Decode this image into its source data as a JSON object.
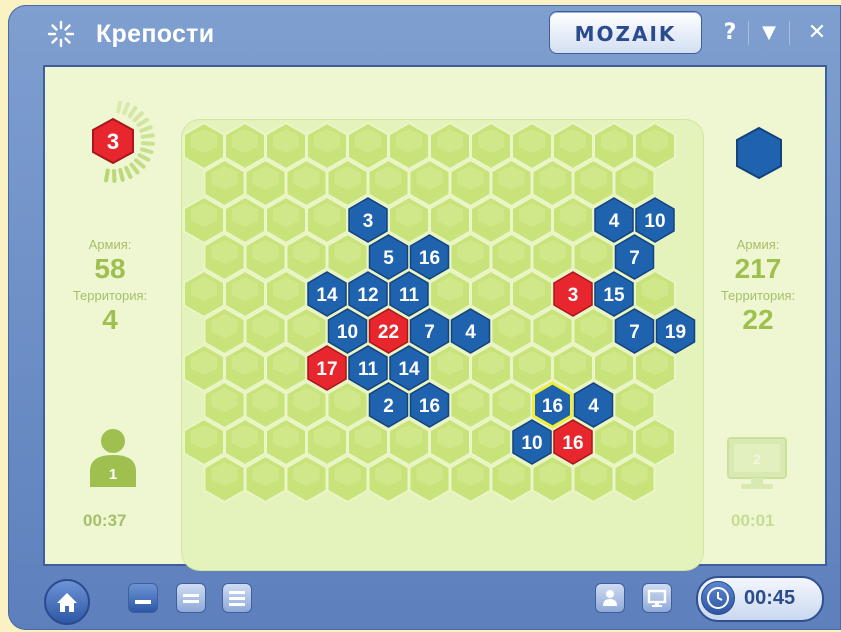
{
  "window": {
    "title": "Крепости",
    "brand": "MOZAIK"
  },
  "controls": {
    "help": "?",
    "menu": "▼",
    "close": "✕"
  },
  "player1": {
    "turn_value": "3",
    "army_label": "Армия:",
    "army": "58",
    "territory_label": "Территория:",
    "territory": "4",
    "avatar_number": "1",
    "time": "00:37",
    "color": "#e8262d"
  },
  "player2": {
    "army_label": "Армия:",
    "army": "217",
    "territory_label": "Территория:",
    "territory": "22",
    "avatar_number": "2",
    "time": "00:01",
    "color": "#1f62ad"
  },
  "bottom": {
    "total_time": "00:45"
  },
  "board": {
    "cols": 12,
    "rows": 10,
    "cells": [
      {
        "c": 4,
        "r": 2,
        "owner": "blue",
        "value": "3"
      },
      {
        "c": 10,
        "r": 2,
        "owner": "blue",
        "value": "4"
      },
      {
        "c": 11,
        "r": 2,
        "owner": "blue",
        "value": "10"
      },
      {
        "c": 4,
        "r": 3,
        "owner": "blue",
        "value": "5"
      },
      {
        "c": 5,
        "r": 3,
        "owner": "blue",
        "value": "16"
      },
      {
        "c": 10,
        "r": 3,
        "owner": "blue",
        "value": "7"
      },
      {
        "c": 3,
        "r": 4,
        "owner": "blue",
        "value": "14"
      },
      {
        "c": 4,
        "r": 4,
        "owner": "blue",
        "value": "12"
      },
      {
        "c": 5,
        "r": 4,
        "owner": "blue",
        "value": "11"
      },
      {
        "c": 9,
        "r": 4,
        "owner": "red",
        "value": "3"
      },
      {
        "c": 10,
        "r": 4,
        "owner": "blue",
        "value": "15"
      },
      {
        "c": 3,
        "r": 5,
        "owner": "blue",
        "value": "10"
      },
      {
        "c": 4,
        "r": 5,
        "owner": "red",
        "value": "22"
      },
      {
        "c": 5,
        "r": 5,
        "owner": "blue",
        "value": "7"
      },
      {
        "c": 6,
        "r": 5,
        "owner": "blue",
        "value": "4"
      },
      {
        "c": 10,
        "r": 5,
        "owner": "blue",
        "value": "7"
      },
      {
        "c": 11,
        "r": 5,
        "owner": "blue",
        "value": "19"
      },
      {
        "c": 3,
        "r": 6,
        "owner": "red",
        "value": "17"
      },
      {
        "c": 4,
        "r": 6,
        "owner": "blue",
        "value": "11"
      },
      {
        "c": 5,
        "r": 6,
        "owner": "blue",
        "value": "14"
      },
      {
        "c": 4,
        "r": 7,
        "owner": "blue",
        "value": "2"
      },
      {
        "c": 5,
        "r": 7,
        "owner": "blue",
        "value": "16"
      },
      {
        "c": 8,
        "r": 7,
        "owner": "blue",
        "value": "16",
        "selected": true
      },
      {
        "c": 9,
        "r": 7,
        "owner": "blue",
        "value": "4"
      },
      {
        "c": 8,
        "r": 8,
        "owner": "blue",
        "value": "10"
      },
      {
        "c": 9,
        "r": 8,
        "owner": "red",
        "value": "16"
      }
    ]
  }
}
